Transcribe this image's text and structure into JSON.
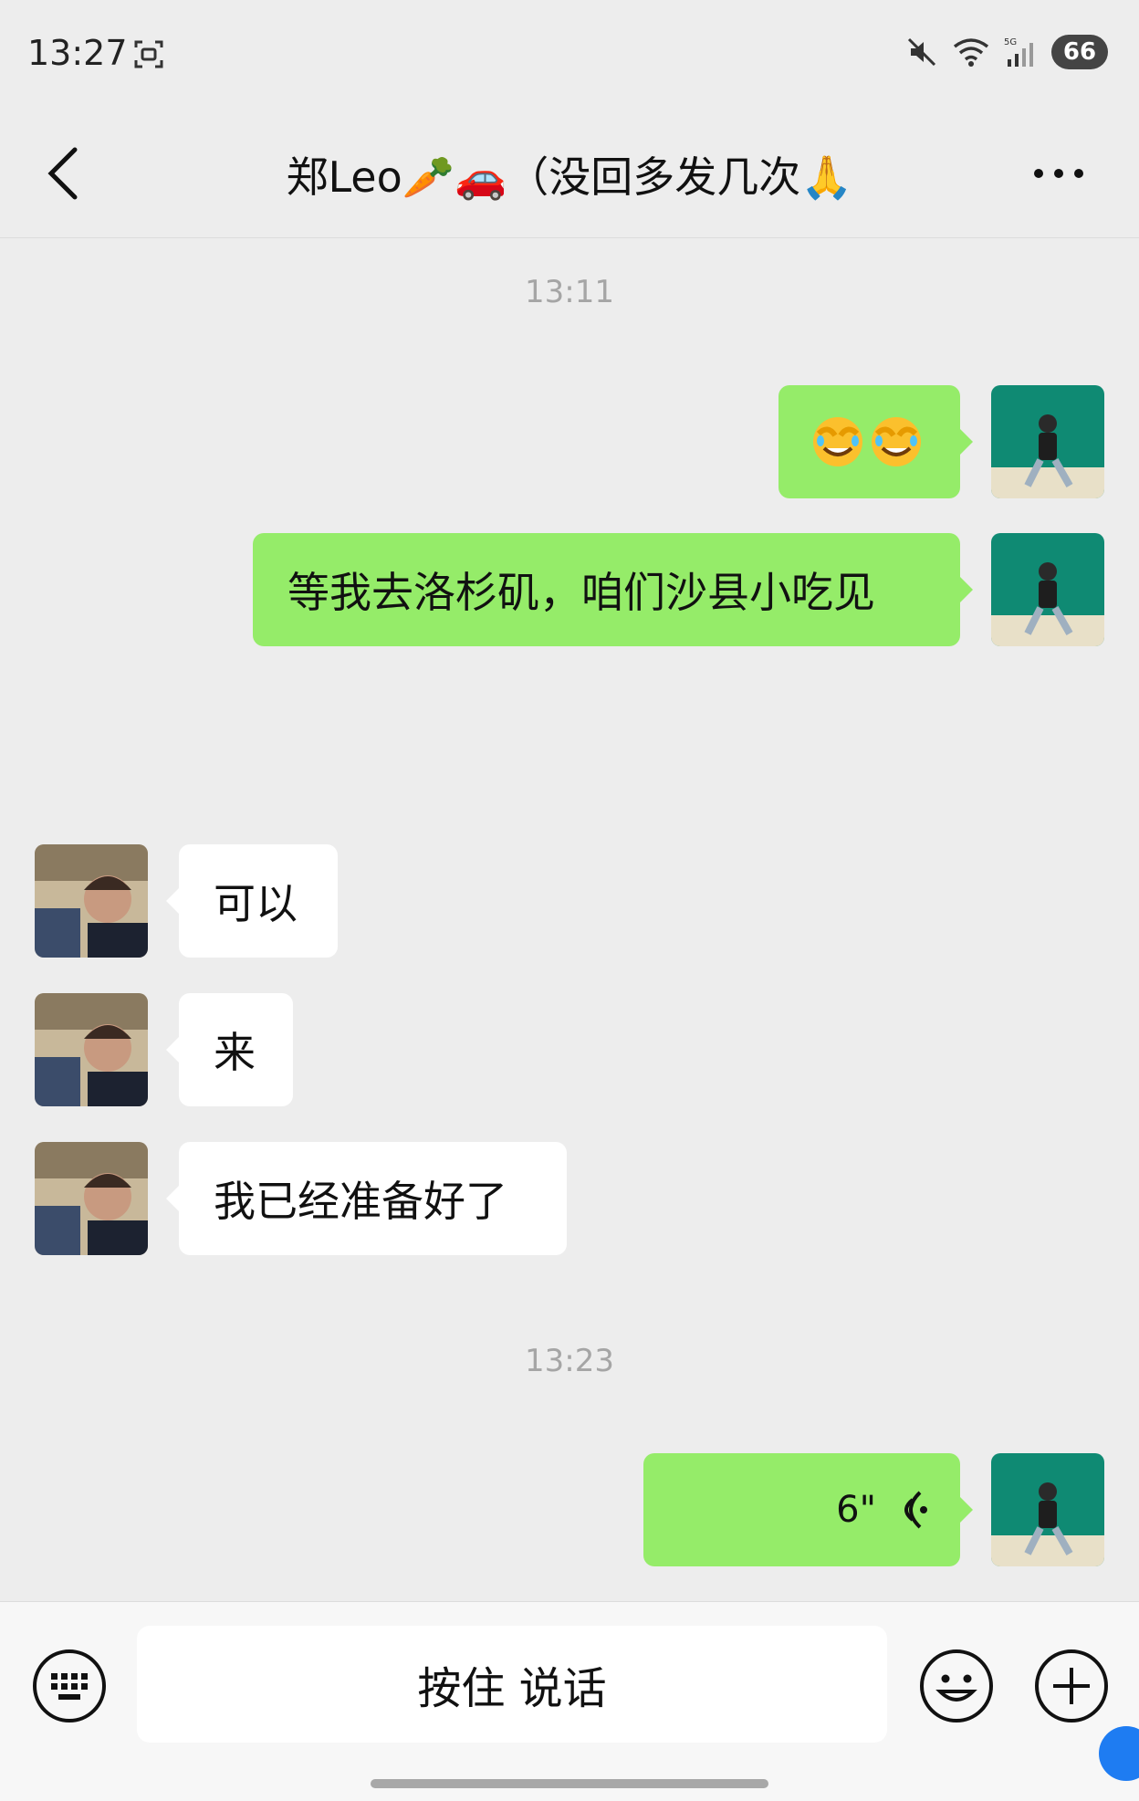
{
  "status_bar": {
    "time": "13:27",
    "battery": "66",
    "icons": [
      "screen-record-icon",
      "mute-icon",
      "wifi-icon",
      "signal-5g-icon",
      "battery-icon"
    ]
  },
  "header": {
    "title": "郑Leo🥕🚗（没回多发几次🙏",
    "back_icon": "chevron-left-icon",
    "more_icon": "ellipsis-icon"
  },
  "messages": {
    "ts1": "13:11",
    "m1_emoji": "face-with-tears-of-joy covering-face emoji x2",
    "m2": "等我去洛杉矶，咱们沙县小吃见",
    "m3": "可以",
    "m4": "来",
    "m5": "我已经准备好了",
    "ts2": "13:23",
    "voice_duration": "6\"",
    "voice_icon": "voice-wave-icon"
  },
  "input": {
    "hold_to_talk": "按住 说话",
    "keyboard_icon": "keyboard-icon",
    "emoji_icon": "smiley-icon",
    "plus_icon": "plus-circle-icon"
  },
  "colors": {
    "background": "#ededed",
    "my_bubble": "#95ec69",
    "their_bubble": "#ffffff",
    "timestamp": "#a5a5a5"
  }
}
